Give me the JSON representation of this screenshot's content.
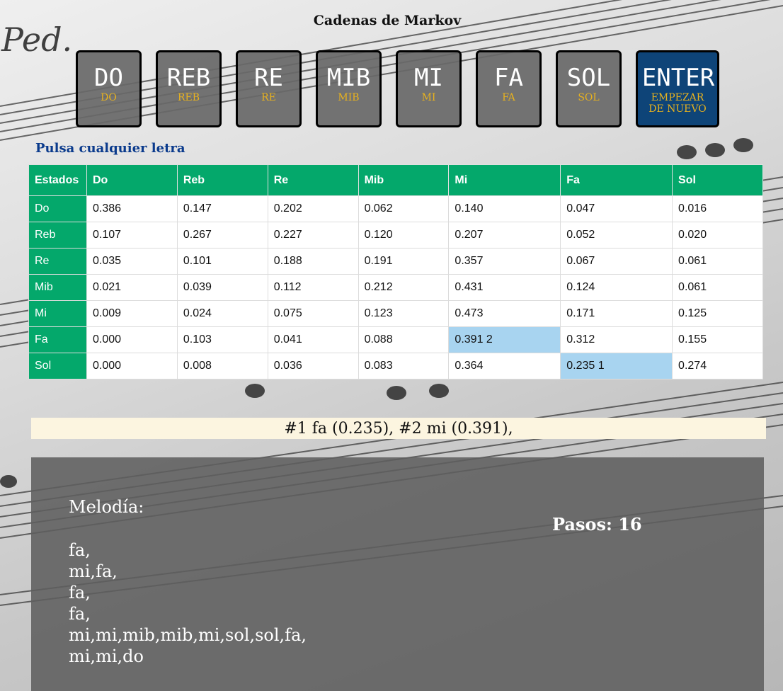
{
  "page": {
    "title": "Cadenas de Markov",
    "hint": "Pulsa cualquier letra"
  },
  "keys": [
    {
      "main": "DO",
      "sub": "DO"
    },
    {
      "main": "REB",
      "sub": "REB"
    },
    {
      "main": "RE",
      "sub": "RE"
    },
    {
      "main": "MIB",
      "sub": "MIB"
    },
    {
      "main": "MI",
      "sub": "MI"
    },
    {
      "main": "FA",
      "sub": "FA"
    },
    {
      "main": "SOL",
      "sub": "SOL"
    }
  ],
  "enter_key": {
    "main": "ENTER",
    "sub_line1": "EMPEZAR",
    "sub_line2": "DE NUEVO"
  },
  "table": {
    "headers": [
      "Estados",
      "Do",
      "Reb",
      "Re",
      "Mib",
      "Mi",
      "Fa",
      "Sol"
    ],
    "rows": [
      {
        "state": "Do",
        "values": [
          "0.386",
          "0.147",
          "0.202",
          "0.062",
          "0.140",
          "0.047",
          "0.016"
        ]
      },
      {
        "state": "Reb",
        "values": [
          "0.107",
          "0.267",
          "0.227",
          "0.120",
          "0.207",
          "0.052",
          "0.020"
        ]
      },
      {
        "state": "Re",
        "values": [
          "0.035",
          "0.101",
          "0.188",
          "0.191",
          "0.357",
          "0.067",
          "0.061"
        ]
      },
      {
        "state": "Mib",
        "values": [
          "0.021",
          "0.039",
          "0.112",
          "0.212",
          "0.431",
          "0.124",
          "0.061"
        ]
      },
      {
        "state": "Mi",
        "values": [
          "0.009",
          "0.024",
          "0.075",
          "0.123",
          "0.473",
          "0.171",
          "0.125"
        ]
      },
      {
        "state": "Fa",
        "values": [
          "0.000",
          "0.103",
          "0.041",
          "0.088",
          "0.391 2",
          "0.312",
          "0.155"
        ]
      },
      {
        "state": "Sol",
        "values": [
          "0.000",
          "0.008",
          "0.036",
          "0.083",
          "0.364",
          "0.235 1",
          "0.274"
        ]
      }
    ],
    "highlight_color": "#a8d4f0",
    "header_color": "#04a86b"
  },
  "ranking": "#1 fa (0.235), #2 mi (0.391),",
  "panel": {
    "melody_label": "Melodía:",
    "steps_label": "Pasos: 16",
    "melody_lines": [
      "fa,",
      "mi,fa,",
      "fa,",
      "fa,",
      "mi,mi,mib,mib,mi,sol,sol,fa,",
      "mi,mi,do"
    ]
  }
}
